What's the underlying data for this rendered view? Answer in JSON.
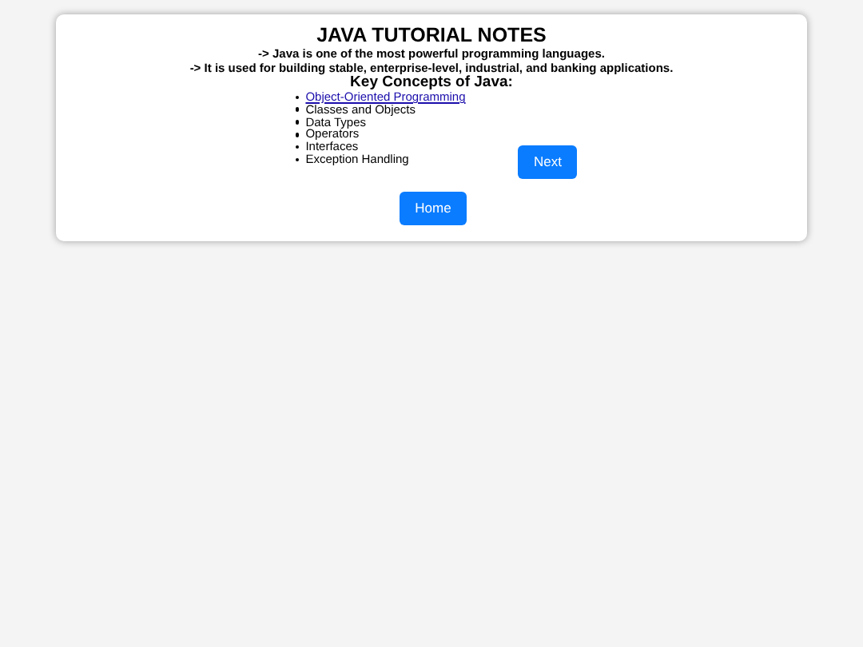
{
  "title": "JAVA TUTORIAL NOTES",
  "intro": [
    "-> Java is one of the most powerful programming languages.",
    "-> It is used for building stable, enterprise-level, industrial, and banking applications."
  ],
  "concepts_heading": "Key Concepts of Java:",
  "concepts": [
    {
      "kind": "link",
      "label": "Object-Oriented Programming"
    },
    {
      "kind": "text",
      "label": "Classes and Objects"
    },
    {
      "kind": "text",
      "label": "Data Types"
    },
    {
      "kind": "text",
      "label": "Operators"
    },
    {
      "kind": "text",
      "label": "Interfaces"
    },
    {
      "kind": "text",
      "label": "Exception Handling"
    }
  ],
  "next_button": "Next",
  "home_button": "Home"
}
